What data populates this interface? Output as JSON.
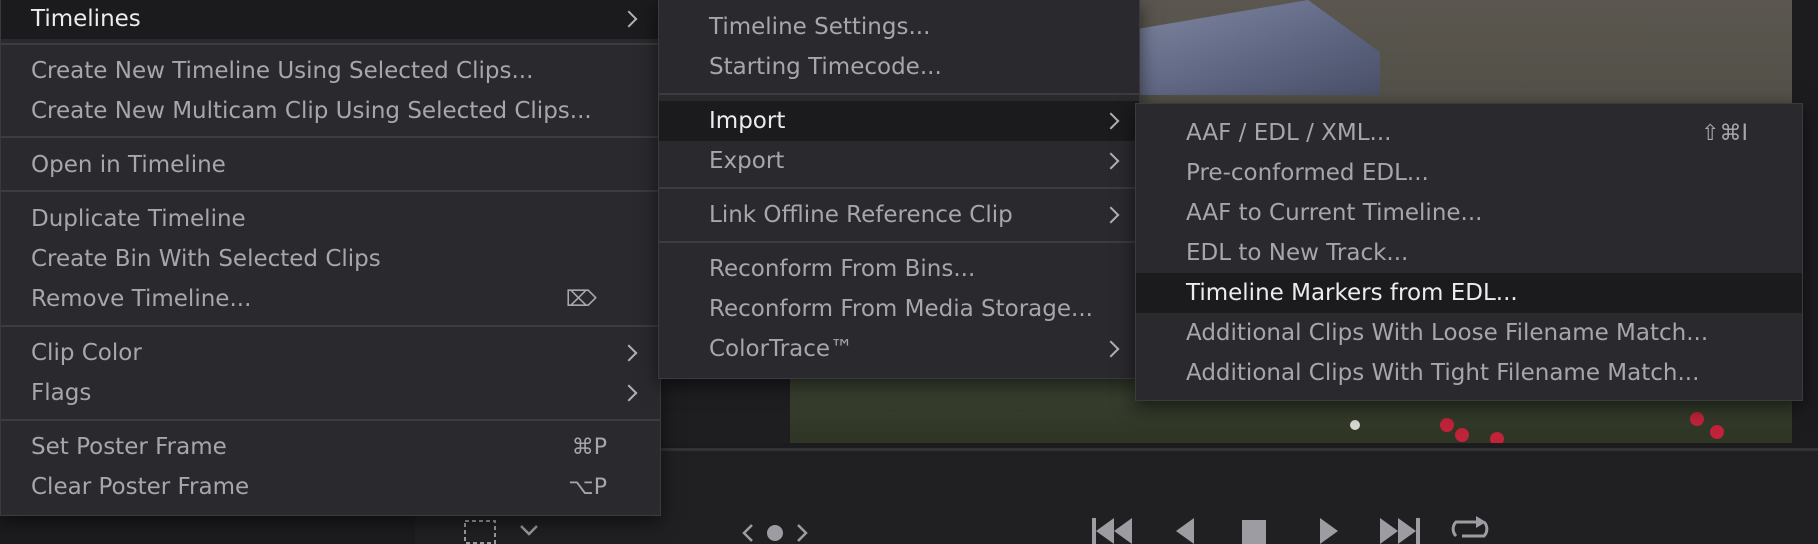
{
  "menu_main": {
    "title_item": {
      "label": "Timelines"
    },
    "items": [
      {
        "label": "Create New Timeline Using Selected Clips..."
      },
      {
        "label": "Create New Multicam Clip Using Selected Clips..."
      },
      {
        "label": "Open in Timeline"
      },
      {
        "label": "Duplicate Timeline"
      },
      {
        "label": "Create Bin With Selected Clips"
      },
      {
        "label": "Remove Timeline...",
        "shortcut": "⌦"
      },
      {
        "label": "Clip Color"
      },
      {
        "label": "Flags"
      },
      {
        "label": "Set Poster Frame",
        "shortcut": "⌘P"
      },
      {
        "label": "Clear Poster Frame",
        "shortcut": "⌥P"
      }
    ]
  },
  "menu_timelines": {
    "items": [
      {
        "label": "Timeline Settings..."
      },
      {
        "label": "Starting Timecode..."
      },
      {
        "label": "Import"
      },
      {
        "label": "Export"
      },
      {
        "label": "Link Offline Reference Clip"
      },
      {
        "label": "Reconform From Bins..."
      },
      {
        "label": "Reconform From Media Storage..."
      },
      {
        "label": "ColorTrace™"
      }
    ]
  },
  "menu_import": {
    "items": [
      {
        "label": "AAF / EDL / XML...",
        "shortcut": "⇧⌘I"
      },
      {
        "label": "Pre-conformed EDL..."
      },
      {
        "label": "AAF to Current Timeline..."
      },
      {
        "label": "EDL to New Track..."
      },
      {
        "label": "Timeline Markers from EDL..."
      },
      {
        "label": "Additional Clips With Loose Filename Match..."
      },
      {
        "label": "Additional Clips With Tight Filename Match..."
      }
    ]
  },
  "colors": {
    "menu_bg": "#2a2a2e",
    "highlight_bg": "#1b1b1e",
    "text": "#a6a6ab",
    "text_active": "#ececee"
  }
}
